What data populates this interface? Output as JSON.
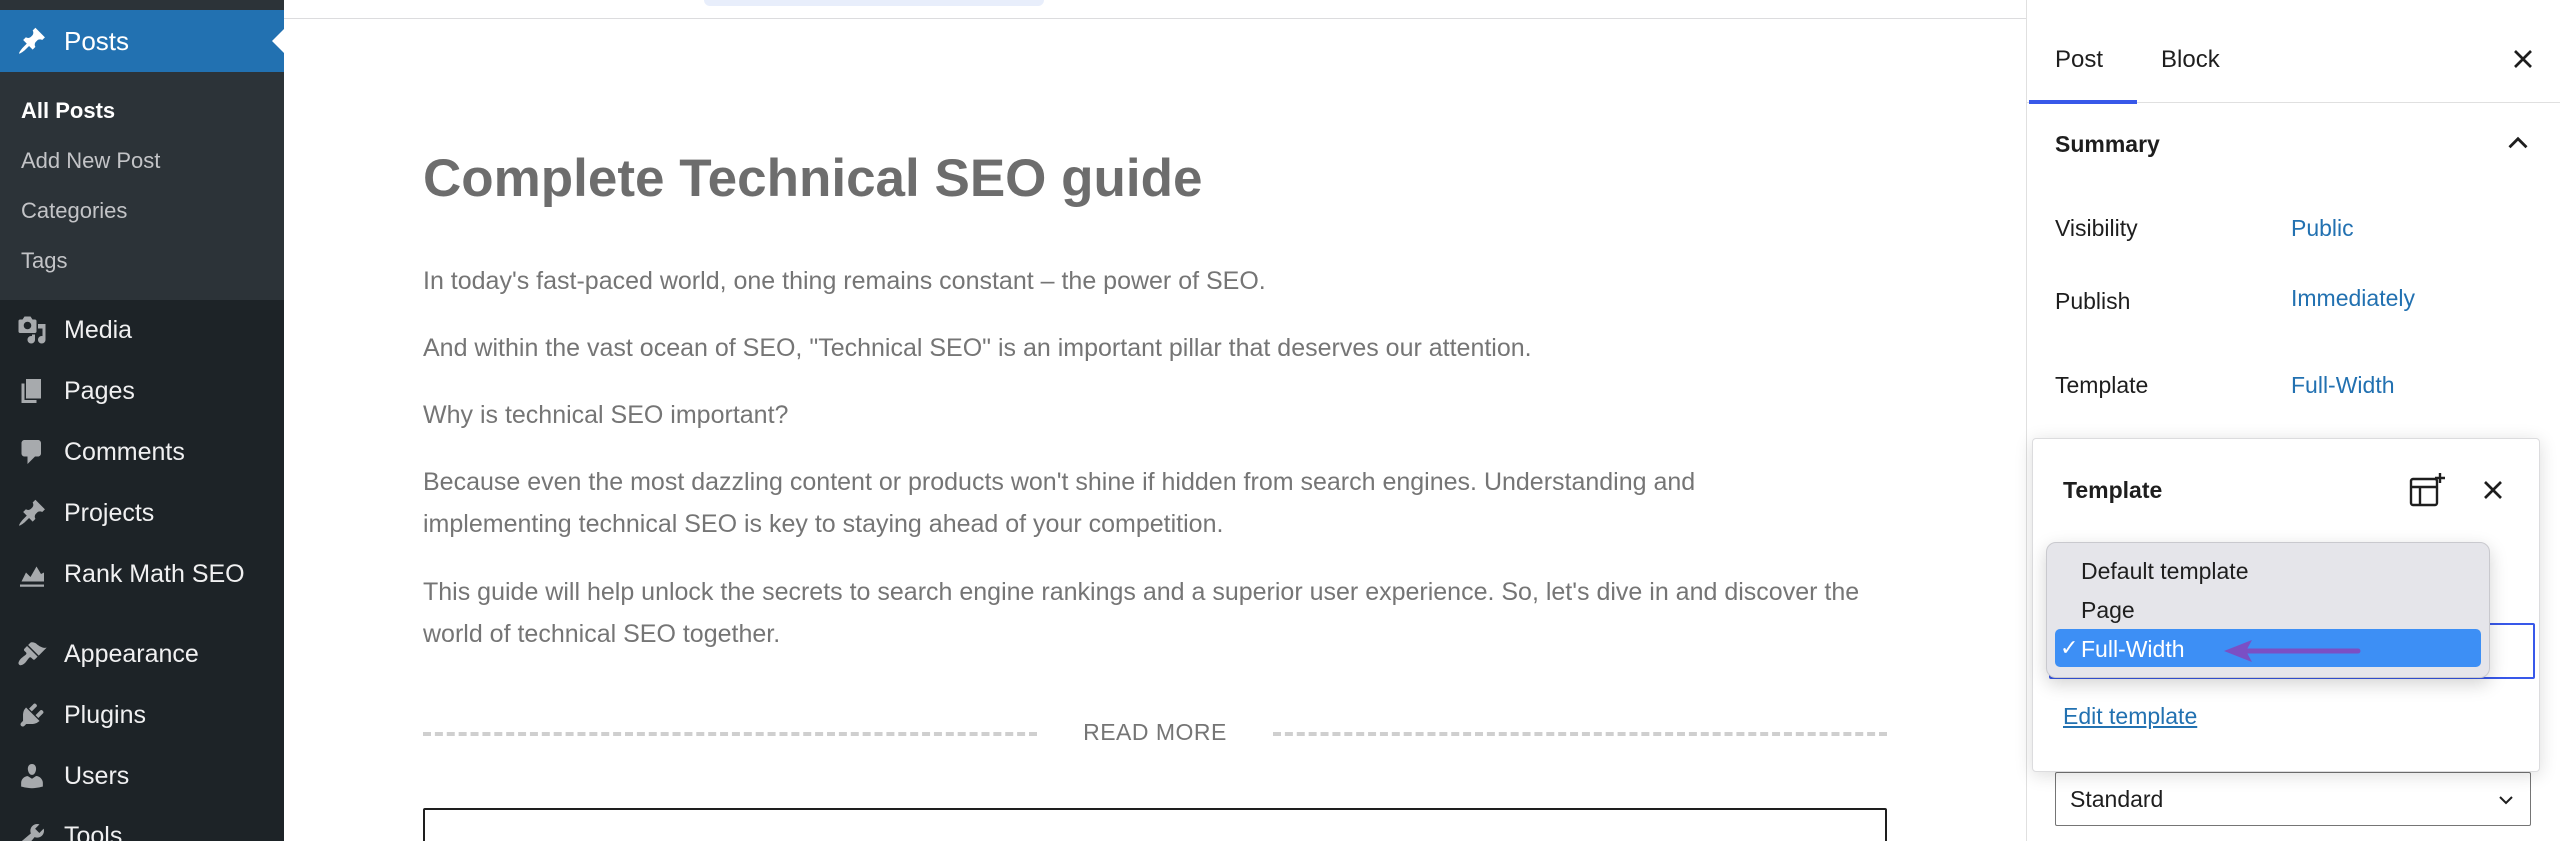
{
  "sidebar": {
    "posts_label": "Posts",
    "submenu": [
      "All Posts",
      "Add New Post",
      "Categories",
      "Tags"
    ],
    "items": [
      {
        "label": "Media",
        "icon": "media-icon"
      },
      {
        "label": "Pages",
        "icon": "pages-icon"
      },
      {
        "label": "Comments",
        "icon": "comments-icon"
      },
      {
        "label": "Projects",
        "icon": "projects-icon"
      },
      {
        "label": "Rank Math SEO",
        "icon": "rank-math-icon"
      },
      {
        "label": "Appearance",
        "icon": "appearance-icon"
      },
      {
        "label": "Plugins",
        "icon": "plugins-icon"
      },
      {
        "label": "Users",
        "icon": "users-icon"
      },
      {
        "label": "Tools",
        "icon": "tools-icon"
      }
    ]
  },
  "post": {
    "title": "Complete Technical SEO guide",
    "paragraphs": [
      "In today's fast-paced world, one thing remains constant – the power of SEO.",
      "And within the vast ocean of SEO, \"Technical SEO\" is an important pillar that deserves our attention.",
      "Why is technical SEO important?",
      "Because even the most dazzling content or products won't shine if hidden from search engines. Understanding and implementing technical SEO is key to staying ahead of your competition.",
      "This guide will help unlock the secrets to search engine rankings and a superior user experience. So, let's dive in and discover the world of technical SEO together."
    ],
    "read_more": "READ MORE"
  },
  "settings": {
    "tabs": {
      "post": "Post",
      "block": "Block"
    },
    "summary": "Summary",
    "visibility": {
      "label": "Visibility",
      "value": "Public"
    },
    "publish": {
      "label": "Publish",
      "value": "Immediately"
    },
    "template": {
      "label": "Template",
      "value": "Full-Width"
    },
    "format_value": "Standard"
  },
  "template_popover": {
    "title": "Template",
    "options": [
      "Default template",
      "Page",
      "Full-Width"
    ],
    "selected": "Full-Width",
    "edit_link": "Edit template"
  },
  "colors": {
    "admin_bg": "#1d2327",
    "active_blue": "#2271b1",
    "tab_accent": "#3858e9",
    "selected_option": "#3d8ff5",
    "arrow": "#7b4fc4"
  }
}
